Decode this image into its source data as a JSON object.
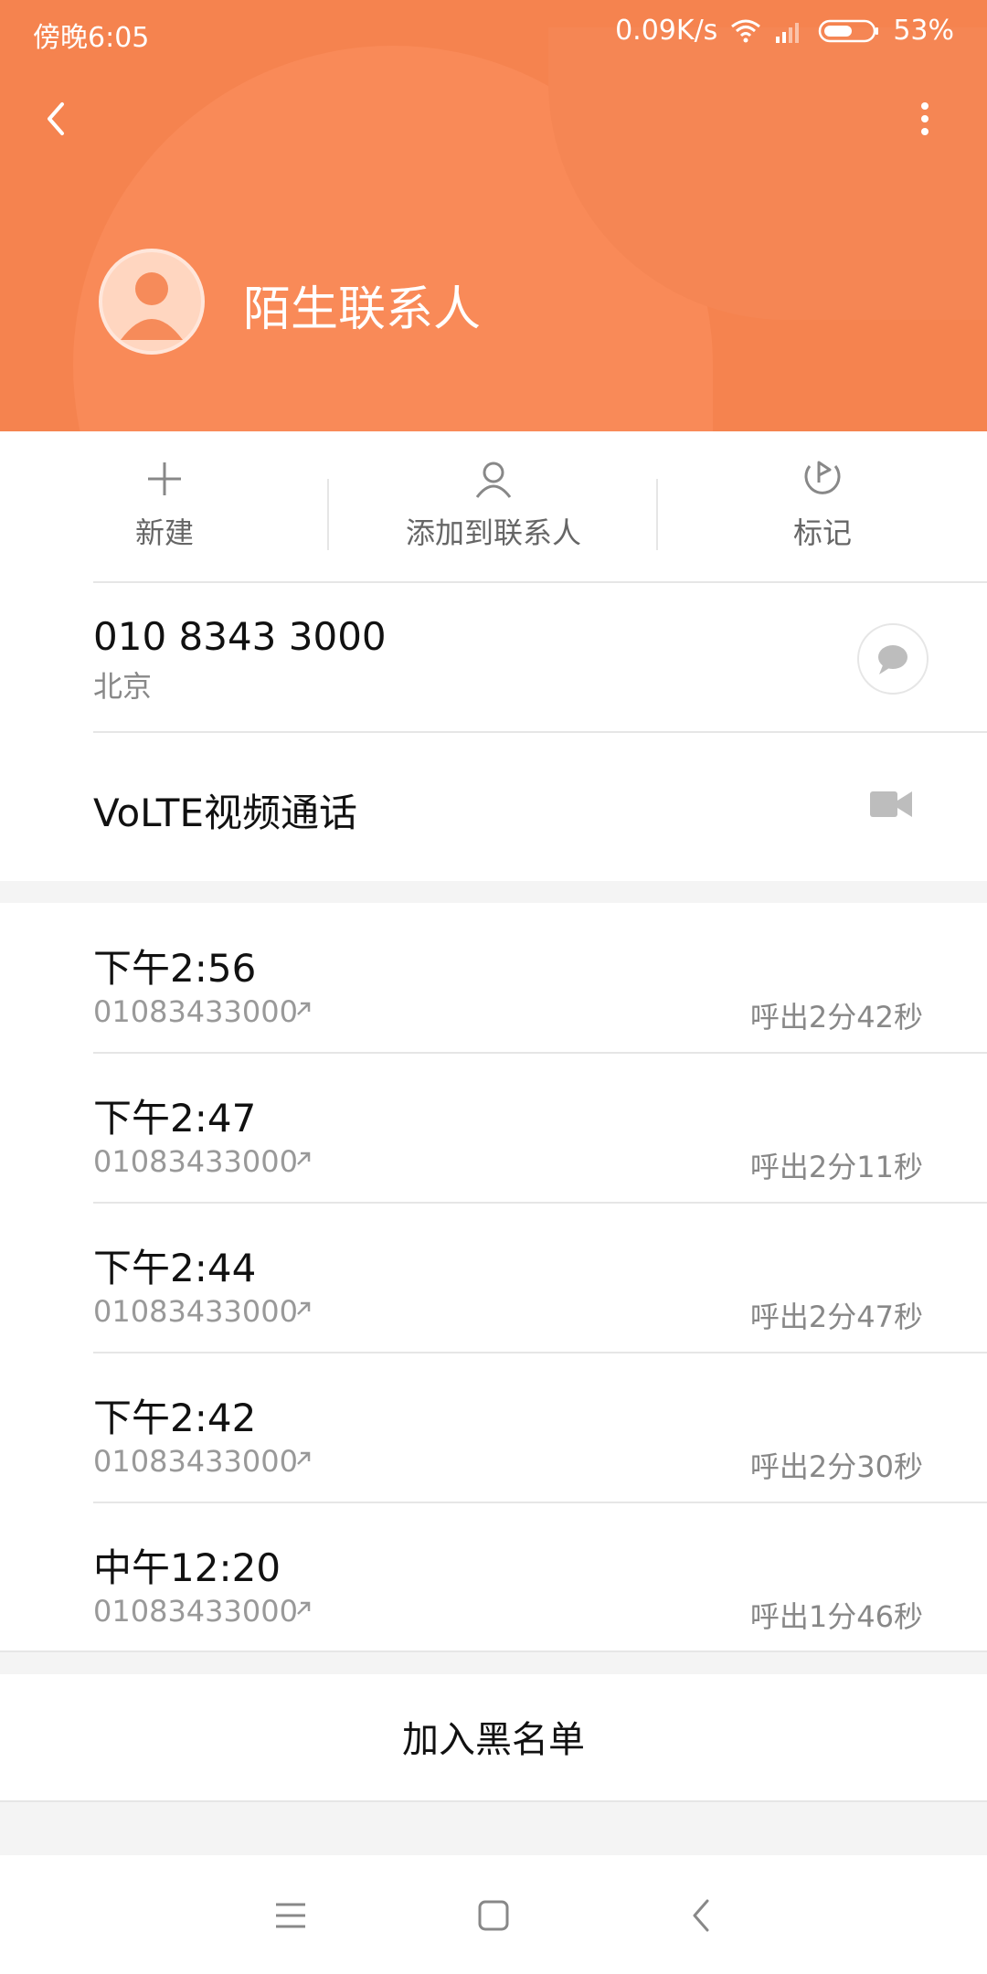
{
  "status_bar": {
    "time": "傍晚6:05",
    "network_speed": "0.09K/s",
    "battery": "53%",
    "icons": [
      "wifi-icon",
      "signal-icon",
      "battery-icon"
    ]
  },
  "header": {
    "contact_name": "陌生联系人",
    "back_icon": "back-arrow-icon",
    "more_icon": "more-vertical-icon",
    "accent_color": "#f5834f"
  },
  "actions": [
    {
      "label": "新建",
      "icon": "plus-icon"
    },
    {
      "label": "添加到联系人",
      "icon": "person-icon"
    },
    {
      "label": "标记",
      "icon": "flag-icon"
    }
  ],
  "phone": {
    "number": "010 8343 3000",
    "location": "北京",
    "message_icon": "message-icon"
  },
  "video_call": {
    "label": "VoLTE视频通话",
    "icon": "video-camera-icon"
  },
  "call_log": [
    {
      "time": "下午2:56",
      "number": "01083433000",
      "duration": "呼出2分42秒"
    },
    {
      "time": "下午2:47",
      "number": "01083433000",
      "duration": "呼出2分11秒"
    },
    {
      "time": "下午2:44",
      "number": "01083433000",
      "duration": "呼出2分47秒"
    },
    {
      "time": "下午2:42",
      "number": "01083433000",
      "duration": "呼出2分30秒"
    },
    {
      "time": "中午12:20",
      "number": "01083433000",
      "duration": "呼出1分46秒"
    }
  ],
  "blacklist_label": "加入黑名单",
  "nav_bar": {
    "icons": [
      "menu-icon",
      "home-icon",
      "back-icon"
    ]
  }
}
